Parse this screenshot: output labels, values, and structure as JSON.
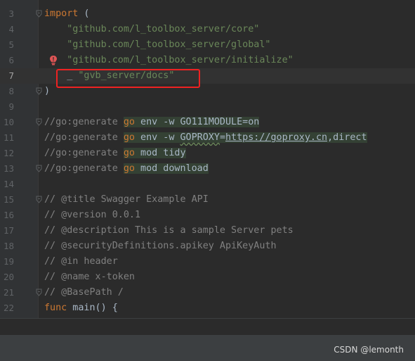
{
  "editor": {
    "lines": [
      {
        "n": "3",
        "tokens": [
          [
            "kw",
            "import"
          ],
          [
            "p",
            " ("
          ]
        ]
      },
      {
        "n": "4",
        "tokens": [
          [
            "p",
            "    "
          ],
          [
            "str",
            "\"github.com/l_toolbox_server/core\""
          ]
        ]
      },
      {
        "n": "5",
        "tokens": [
          [
            "p",
            "    "
          ],
          [
            "str",
            "\"github.com/l_toolbox_server/global\""
          ]
        ]
      },
      {
        "n": "6",
        "tokens": [
          [
            "p",
            "    "
          ],
          [
            "str",
            "\"github.com/l_toolbox_server/initialize\""
          ]
        ]
      },
      {
        "n": "7",
        "tokens": [
          [
            "p",
            "    _ "
          ],
          [
            "str",
            "\"gvb_server/docs\""
          ]
        ]
      },
      {
        "n": "8",
        "tokens": [
          [
            "p",
            ")"
          ]
        ]
      },
      {
        "n": "9",
        "tokens": []
      },
      {
        "n": "10",
        "tokens": [
          [
            "cm",
            "//go:generate "
          ],
          [
            "kwhl",
            "go"
          ],
          [
            "hl",
            " env -w GO111MODULE=on"
          ]
        ]
      },
      {
        "n": "11",
        "tokens": [
          [
            "cm",
            "//go:generate "
          ],
          [
            "kwhl",
            "go"
          ],
          [
            "hl",
            " env -w "
          ],
          [
            "hltypo",
            "GOPROXY"
          ],
          [
            "hl",
            "="
          ],
          [
            "hlurl",
            "https://goproxy.cn"
          ],
          [
            "hl",
            ",direct"
          ]
        ]
      },
      {
        "n": "12",
        "tokens": [
          [
            "cm",
            "//go:generate "
          ],
          [
            "kwhl",
            "go"
          ],
          [
            "hl",
            " mod tidy"
          ]
        ]
      },
      {
        "n": "13",
        "tokens": [
          [
            "cm",
            "//go:generate "
          ],
          [
            "kwhl",
            "go"
          ],
          [
            "hl",
            " mod download"
          ]
        ]
      },
      {
        "n": "14",
        "tokens": []
      },
      {
        "n": "15",
        "tokens": [
          [
            "cm",
            "// @title Swagger Example API"
          ]
        ]
      },
      {
        "n": "16",
        "tokens": [
          [
            "cm",
            "// @version 0.0.1"
          ]
        ]
      },
      {
        "n": "17",
        "tokens": [
          [
            "cm",
            "// @description This is a sample Server pets"
          ]
        ]
      },
      {
        "n": "18",
        "tokens": [
          [
            "cm",
            "// @securityDefinitions.apikey ApiKeyAuth"
          ]
        ]
      },
      {
        "n": "19",
        "tokens": [
          [
            "cm",
            "// @in header"
          ]
        ]
      },
      {
        "n": "20",
        "tokens": [
          [
            "cm",
            "// @name x-token"
          ]
        ]
      },
      {
        "n": "21",
        "tokens": [
          [
            "cm",
            "// @BasePath /"
          ]
        ]
      },
      {
        "n": "22",
        "tokens": [
          [
            "kw",
            "func"
          ],
          [
            "p",
            " main() {"
          ]
        ]
      }
    ],
    "current_line": "7",
    "fold_lines": [
      "3",
      "8",
      "10",
      "13",
      "15",
      "21"
    ],
    "bulb_line": "6",
    "highlighted_line": "7"
  },
  "watermark": "CSDN @lemonth",
  "colors": {
    "background": "#2b2b2b",
    "gutter": "#313335",
    "keyword": "#cc7832",
    "string": "#6a8759",
    "comment": "#808080",
    "text": "#a9b7c6",
    "highlight_box": "#ee2222",
    "bulb": "#e05555"
  }
}
